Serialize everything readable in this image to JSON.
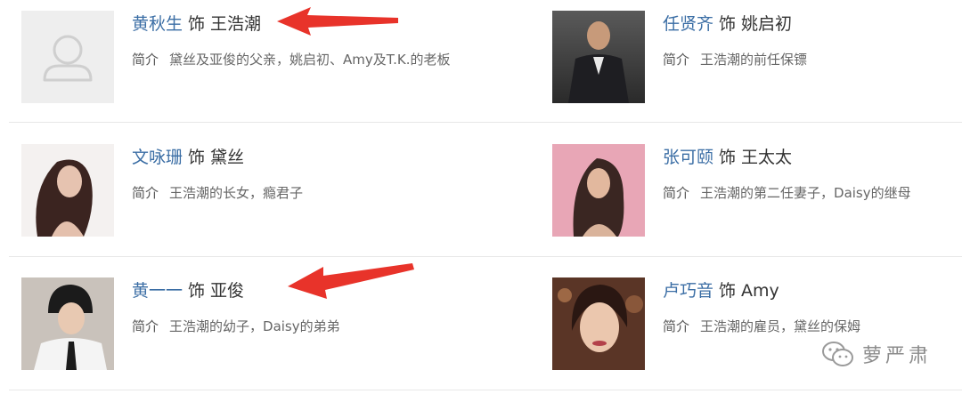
{
  "cards": [
    {
      "actor": "黄秋生",
      "shi": "饰",
      "role": "王浩潮",
      "desc_label": "简介",
      "desc": "黛丝及亚俊的父亲，姚启初、Amy及T.K.的老板",
      "photo": "placeholder-avatar-icon"
    },
    {
      "actor": "任贤齐",
      "shi": "饰",
      "role": "姚启初",
      "desc_label": "简介",
      "desc": "王浩潮的前任保镖",
      "photo": "actor-photo"
    },
    {
      "actor": "文咏珊",
      "shi": "饰",
      "role": "黛丝",
      "desc_label": "简介",
      "desc": "王浩潮的长女，瘾君子",
      "photo": "actor-photo"
    },
    {
      "actor": "张可颐",
      "shi": "饰",
      "role": "王太太",
      "desc_label": "简介",
      "desc": "王浩潮的第二任妻子，Daisy的继母",
      "photo": "actor-photo"
    },
    {
      "actor": "黄一一",
      "shi": "饰",
      "role": "亚俊",
      "desc_label": "简介",
      "desc": "王浩潮的幼子，Daisy的弟弟",
      "photo": "actor-photo"
    },
    {
      "actor": "卢巧音",
      "shi": "饰",
      "role": "Amy",
      "desc_label": "简介",
      "desc": "王浩潮的雇员，黛丝的保姆",
      "photo": "actor-photo"
    }
  ],
  "watermark": {
    "text": "萝严肃",
    "icon": "wechat-icon"
  },
  "colors": {
    "actor_link": "#3b6ea5",
    "arrow": "#e8332a",
    "separator": "#e8e8e8"
  }
}
